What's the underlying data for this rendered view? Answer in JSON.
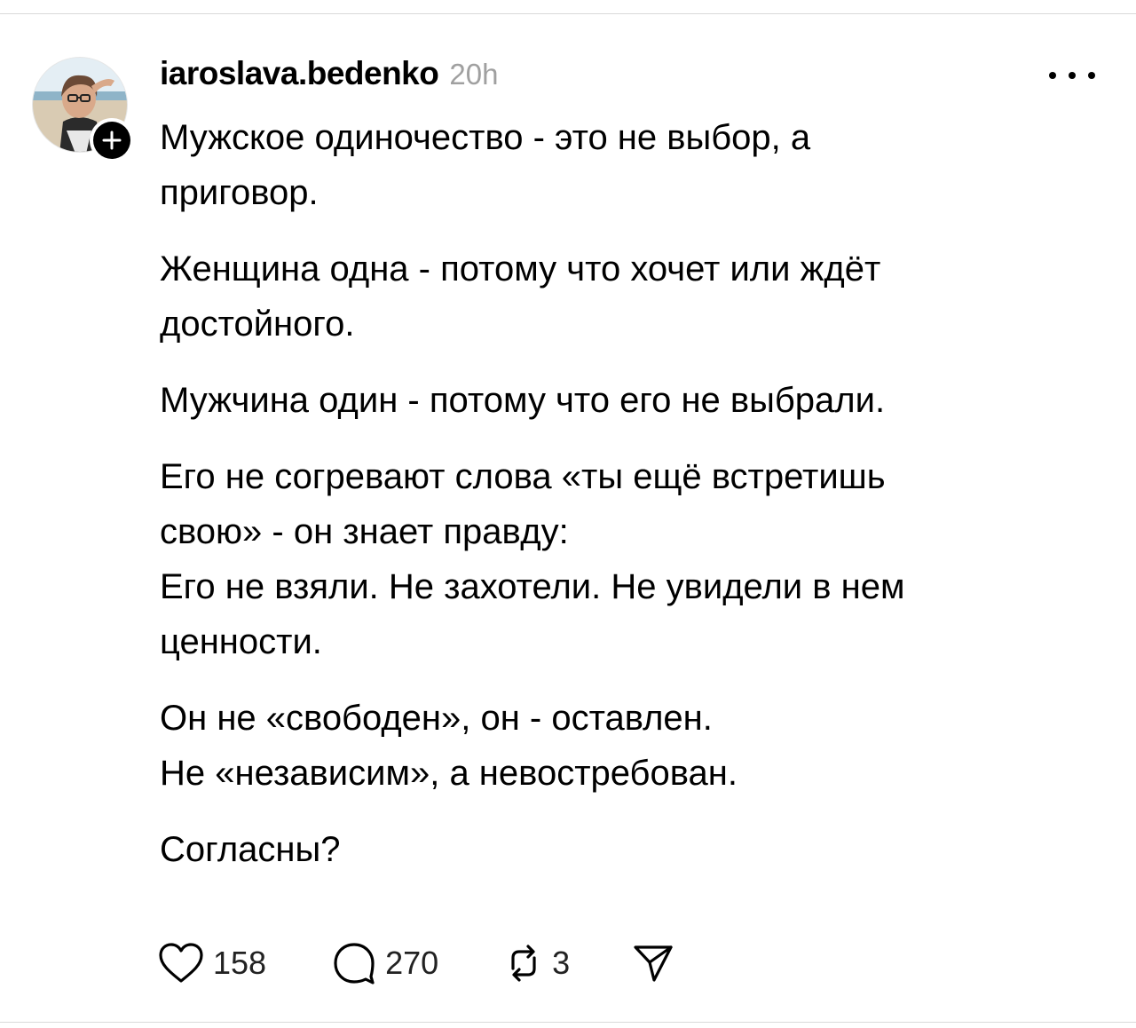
{
  "post": {
    "author": {
      "username": "iaroslava.bedenko",
      "avatar": "profile-photo",
      "follow_icon": "plus-icon"
    },
    "timestamp": "20h",
    "menu_icon": "more-horizontal-icon",
    "paragraphs": [
      {
        "lines": [
          "Мужское одиночество - это не выбор, а",
          "приговор."
        ]
      },
      {
        "lines": [
          "Женщина одна - потому что хочет или ждёт",
          "достойного."
        ]
      },
      {
        "lines": [
          "Мужчина один - потому что его не выбрали."
        ]
      },
      {
        "lines": [
          "Его не согревают слова «ты ещё встретишь",
          "свою» - он знает правду:",
          "Его не взяли. Не захотели. Не увидели в нем",
          "ценности."
        ]
      },
      {
        "lines": [
          "Он не «свободен», он - оставлен.",
          "Не «независим», а невостребован."
        ]
      },
      {
        "lines": [
          "Согласны?"
        ]
      }
    ],
    "actions": {
      "like": {
        "icon": "heart-icon",
        "count": "158"
      },
      "comment": {
        "icon": "comment-icon",
        "count": "270"
      },
      "repost": {
        "icon": "repost-icon",
        "count": "3"
      },
      "share": {
        "icon": "send-icon"
      }
    }
  }
}
